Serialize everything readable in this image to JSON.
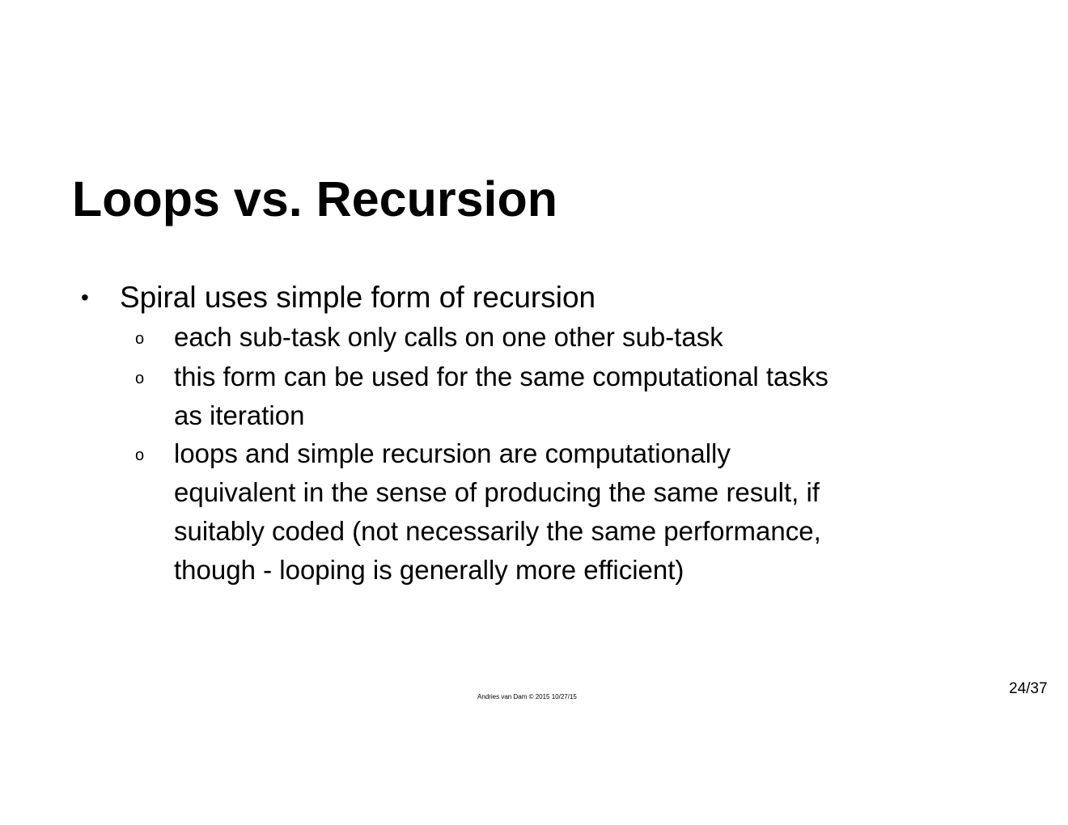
{
  "slide": {
    "title": "Loops vs. Recursion",
    "bullets": [
      {
        "marker": "•",
        "text": "Spiral uses simple form of recursion",
        "sub_items": [
          {
            "marker": "o",
            "lines": [
              "each sub-task only calls on one other sub-task"
            ]
          },
          {
            "marker": "o",
            "lines": [
              "this form can be used for the same computational tasks",
              "as iteration"
            ]
          },
          {
            "marker": "o",
            "lines": [
              "loops and simple recursion are computationally",
              "equivalent in the sense of producing the same result, if",
              "suitably coded (not necessarily the same performance,",
              "though - looping is generally more efficient)"
            ]
          }
        ]
      }
    ]
  },
  "footer": {
    "credit": "Andries van Dam © 2015 10/27/15",
    "page_number": "24/37"
  }
}
